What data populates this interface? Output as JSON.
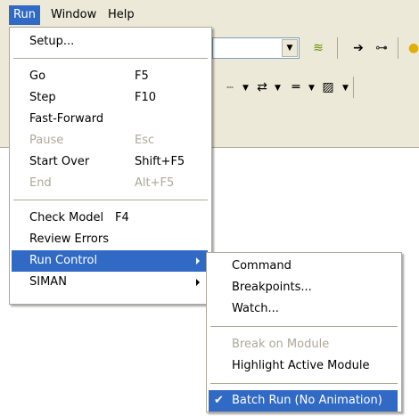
{
  "menubar": {
    "items": [
      {
        "label": "Run",
        "active": true
      },
      {
        "label": "Window",
        "active": false
      },
      {
        "label": "Help",
        "active": false
      }
    ]
  },
  "run_menu": {
    "items": [
      {
        "label": "Setup...",
        "shortcut": ""
      },
      {
        "label": "Go",
        "shortcut": "F5"
      },
      {
        "label": "Step",
        "shortcut": "F10"
      },
      {
        "label": "Fast-Forward",
        "shortcut": ""
      },
      {
        "label": "Pause",
        "shortcut": "Esc",
        "disabled": true
      },
      {
        "label": "Start Over",
        "shortcut": "Shift+F5"
      },
      {
        "label": "End",
        "shortcut": "Alt+F5",
        "disabled": true
      },
      {
        "label": "Check Model",
        "shortcut": "F4"
      },
      {
        "label": "Review Errors",
        "shortcut": ""
      },
      {
        "label": "Run Control",
        "shortcut": "",
        "submenu": true,
        "highlighted": true
      },
      {
        "label": "SIMAN",
        "shortcut": "",
        "submenu": true
      }
    ]
  },
  "run_control_submenu": {
    "items": [
      {
        "label": "Command"
      },
      {
        "label": "Breakpoints..."
      },
      {
        "label": "Watch..."
      },
      {
        "label": "Break on Module",
        "disabled": true
      },
      {
        "label": "Highlight Active Module"
      },
      {
        "label": "Batch Run (No Animation)",
        "checked": true,
        "highlighted": true
      }
    ]
  },
  "icons": {
    "checkmark": "checkmark-icon",
    "submenu_arrow": "submenu-arrow-icon"
  },
  "colors": {
    "highlight": "#316ac5",
    "menubar_bg": "#ece9d8",
    "disabled_text": "#aca899"
  }
}
